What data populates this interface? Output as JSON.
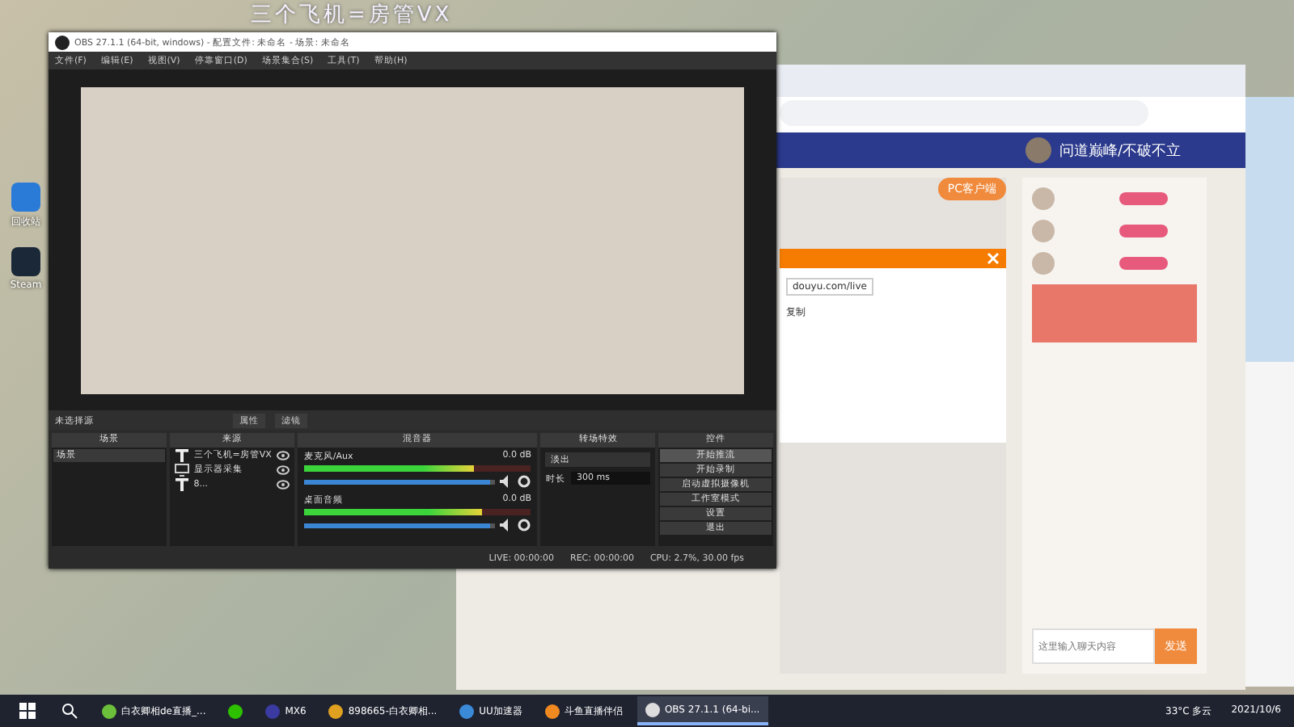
{
  "desktop_icons": [
    {
      "label": "回收站"
    },
    {
      "label": "Steam"
    }
  ],
  "overlay_text": "三个飞机=房管VX",
  "obs": {
    "title": "OBS 27.1.1 (64-bit, windows) - 配置文件: 未命名 - 场景: 未命名",
    "menu": [
      "文件(F)",
      "编辑(E)",
      "视图(V)",
      "停靠窗口(D)",
      "场景集合(S)",
      "工具(T)",
      "帮助(H)"
    ],
    "source_bar": {
      "label": "未选择源",
      "buttons": [
        "属性",
        "滤镜"
      ]
    },
    "docks": {
      "scenes": {
        "title": "场景",
        "items": [
          {
            "label": "场景",
            "selected": true
          }
        ]
      },
      "sources": {
        "title": "来源",
        "items": [
          {
            "label": "三个飞机=房管VX",
            "kind": "text",
            "visible": true
          },
          {
            "label": "显示器采集",
            "kind": "display",
            "visible": true
          },
          {
            "label": "8...",
            "kind": "text",
            "visible": true
          }
        ]
      },
      "mixer": {
        "title": "混音器",
        "tracks": [
          {
            "name": "麦克风/Aux",
            "reading": "0.0 dB",
            "meter": {
              "level": 0.75
            },
            "volume": {
              "level": 0.97
            }
          },
          {
            "name": "桌面音频",
            "reading": "0.0 dB",
            "meter": {
              "level": 0.78
            },
            "volume": {
              "level": 0.97
            }
          }
        ]
      },
      "transitions": {
        "title": "转场特效",
        "transition": "淡出",
        "duration_label": "时长",
        "duration": "300 ms"
      },
      "controls": {
        "title": "控件",
        "buttons": [
          {
            "label": "开始推流",
            "selected": true
          },
          {
            "label": "开始录制",
            "selected": false
          },
          {
            "label": "启动虚拟摄像机",
            "selected": false
          },
          {
            "label": "工作室模式",
            "selected": false
          },
          {
            "label": "设置",
            "selected": false
          },
          {
            "label": "退出",
            "selected": false
          }
        ]
      }
    },
    "status": {
      "live": "LIVE: 00:00:00",
      "rec": "REC: 00:00:00",
      "cpu": "CPU: 2.7%, 30.00 fps"
    }
  },
  "browser": {
    "account": "问道巅峰/不破不立",
    "client_button": "PC客户端",
    "dialog_lines": [
      "douyu.com/live",
      "复制"
    ],
    "chat_placeholder": "这里输入聊天内容",
    "send": "发送"
  },
  "taskbar": {
    "tasks": [
      {
        "label": "白衣卿相de直播_...",
        "active": false
      },
      {
        "active": false
      },
      {
        "label": "MX6",
        "active": false
      },
      {
        "label": "898665-白衣卿相...",
        "active": false
      },
      {
        "label": "UU加速器",
        "active": false
      },
      {
        "label": "斗鱼直播伴侣",
        "active": false
      },
      {
        "label": "OBS 27.1.1 (64-bi...",
        "active": true
      }
    ],
    "weather": "33°C 多云",
    "date": "2021/10/6"
  }
}
